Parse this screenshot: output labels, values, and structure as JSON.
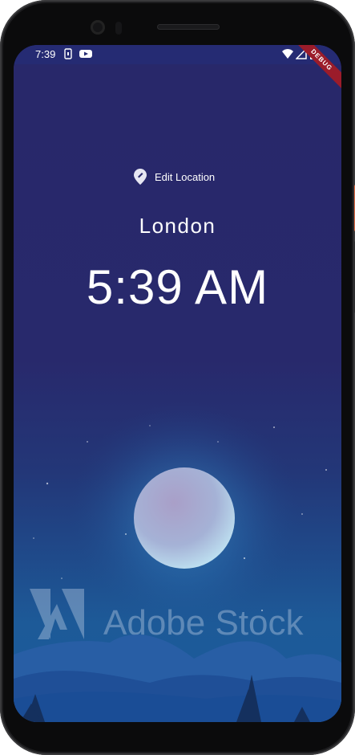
{
  "status_bar": {
    "time": "7:39",
    "icons": [
      "sim-icon",
      "youtube-icon",
      "wifi-icon",
      "signal-icon",
      "battery-icon"
    ]
  },
  "debug_banner": "DEBUG",
  "location": {
    "edit_label": "Edit Location",
    "city": "London",
    "time": "5:39 AM"
  },
  "watermark": "Adobe Stock",
  "colors": {
    "background_top": "#28286a",
    "background_bottom": "#1a5b9c",
    "text": "#ffffff"
  }
}
